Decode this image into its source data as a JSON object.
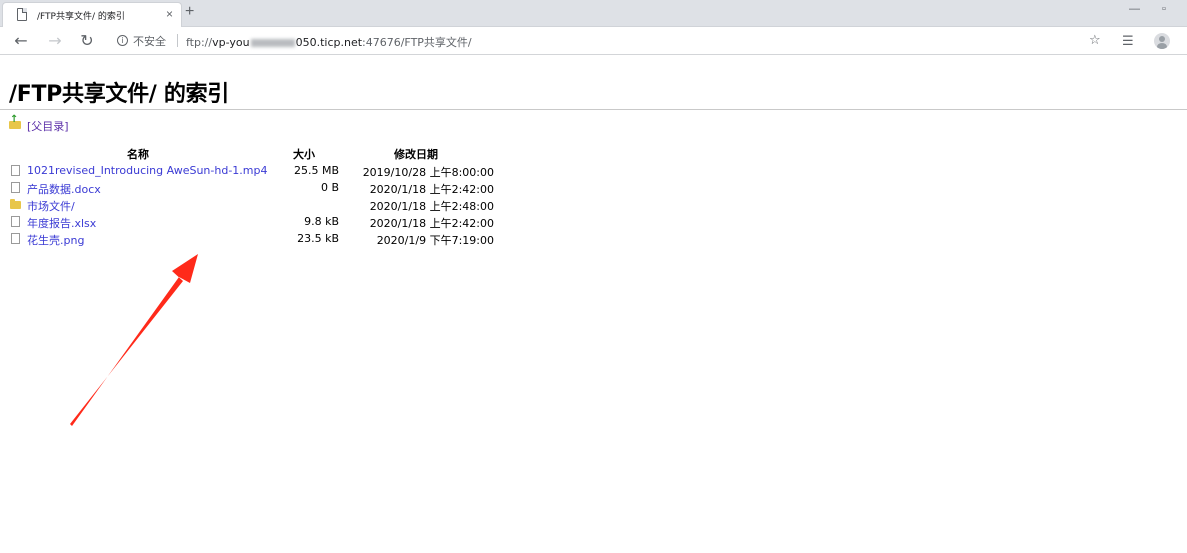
{
  "tab": {
    "title": "/FTP共享文件/ 的索引",
    "close_glyph": "×",
    "new_tab_glyph": "+"
  },
  "window_controls": {
    "minimize_glyph": "—",
    "restore_glyph": "▫"
  },
  "toolbar": {
    "back_glyph": "←",
    "forward_glyph": "→",
    "reload_glyph": "↻",
    "security_label": "不安全",
    "url_scheme": "ftp://",
    "url_host_before_blur": "vp-you",
    "url_host_after_blur": "050.ticp.net",
    "url_rest": ":47676/FTP共享文件/",
    "star_glyph": "☆",
    "reading_list_glyph": "☰"
  },
  "page": {
    "title": "/FTP共享文件/ 的索引",
    "parent_link": "[父目录]",
    "columns": {
      "name": "名称",
      "size": "大小",
      "date": "修改日期"
    },
    "entries": [
      {
        "type": "file",
        "name": "1021revised_Introducing AweSun-hd-1.mp4",
        "size": "25.5 MB",
        "date": "2019/10/28 上午8:00:00"
      },
      {
        "type": "file",
        "name": "产品数据.docx",
        "size": "0 B",
        "date": "2020/1/18 上午2:42:00"
      },
      {
        "type": "folder",
        "name": "市场文件/",
        "size": "",
        "date": "2020/1/18 上午2:48:00"
      },
      {
        "type": "file",
        "name": "年度报告.xlsx",
        "size": "9.8 kB",
        "date": "2020/1/18 上午2:42:00"
      },
      {
        "type": "file",
        "name": "花生壳.png",
        "size": "23.5 kB",
        "date": "2020/1/9 下午7:19:00"
      }
    ]
  },
  "colors": {
    "tabstrip_bg": "#dee1e6",
    "link": "#3a3ad4",
    "visited_link": "#5b2fa8",
    "annotation_arrow": "#ff2a1a"
  }
}
